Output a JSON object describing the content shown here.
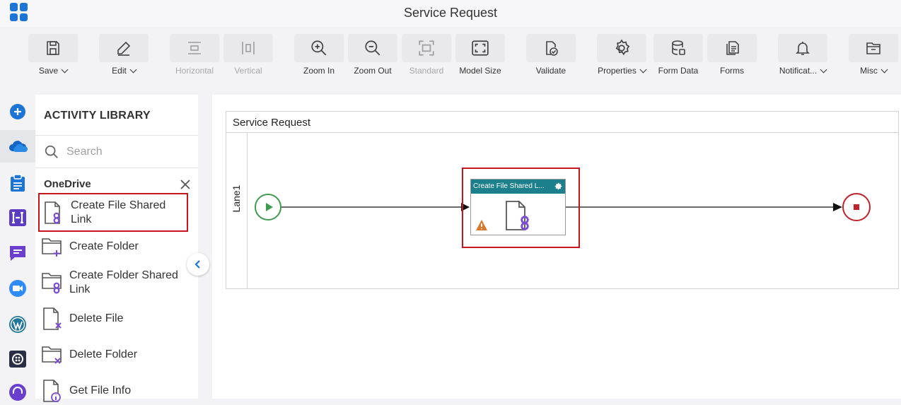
{
  "app": {
    "title": "Service Request"
  },
  "toolbar": {
    "save": "Save",
    "edit": "Edit",
    "horizontal": "Horizontal",
    "vertical": "Vertical",
    "zoom_in": "Zoom In",
    "zoom_out": "Zoom Out",
    "standard": "Standard",
    "model_size": "Model Size",
    "validate": "Validate",
    "properties": "Properties",
    "form_data": "Form Data",
    "forms": "Forms",
    "notifications": "Notificat...",
    "misc": "Misc"
  },
  "library": {
    "title": "ACTIVITY LIBRARY",
    "search_placeholder": "Search",
    "category": "OneDrive",
    "items": [
      {
        "label": "Create File Shared Link",
        "icon": "file-link-icon"
      },
      {
        "label": "Create Folder",
        "icon": "folder-add-icon"
      },
      {
        "label": "Create Folder Shared Link",
        "icon": "folder-link-icon"
      },
      {
        "label": "Delete File",
        "icon": "file-delete-icon"
      },
      {
        "label": "Delete Folder",
        "icon": "folder-delete-icon"
      },
      {
        "label": "Get File Info",
        "icon": "file-info-icon"
      }
    ]
  },
  "canvas": {
    "pool_name": "Service Request",
    "lane_name": "Lane1",
    "activity_title": "Create File Shared L..."
  },
  "colors": {
    "accent": "#1b74d6",
    "selection": "#c8141c",
    "activity_header": "#1b7f8c",
    "start": "#3f9b50",
    "end": "#c0222a",
    "warning": "#d9772a",
    "icon_purple": "#7b4bd6"
  }
}
